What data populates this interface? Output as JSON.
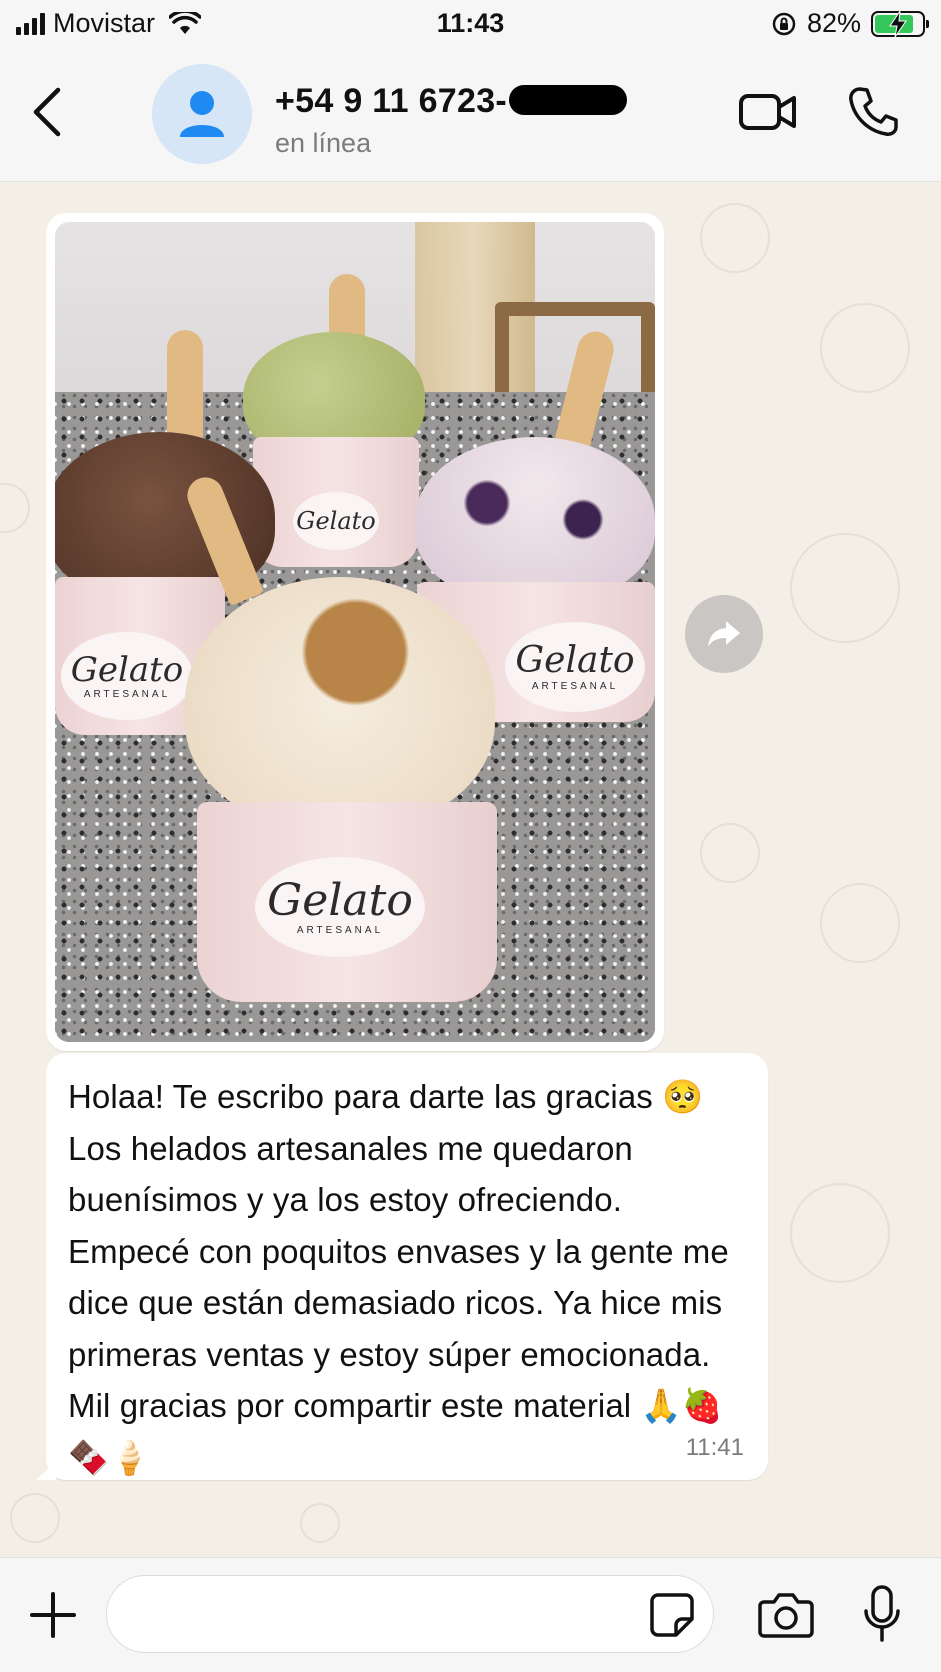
{
  "status_bar": {
    "carrier": "Movistar",
    "time": "11:43",
    "battery_percent": "82%",
    "battery_level": 0.82
  },
  "header": {
    "contact_name": "+54 9 11 6723-",
    "contact_status": "en línea"
  },
  "photo": {
    "cup_brand": "Gelato",
    "cup_subtitle": "ARTESANAL"
  },
  "message": {
    "text": "Holaa! Te escribo para darte las gracias 🥺 Los helados artesanales me quedaron buenísimos y ya los estoy ofreciendo. Empecé con poquitos envases y la gente me dice que están demasiado ricos. Ya hice mis primeras ventas y estoy súper emocionada. Mil gracias por compartir este material 🙏🍓🍫🍦",
    "time": "11:41"
  },
  "input": {
    "placeholder": ""
  },
  "icons": [
    "back-icon",
    "contact-avatar-icon",
    "video-call-icon",
    "phone-call-icon",
    "forward-icon",
    "plus-icon",
    "sticker-icon",
    "camera-icon",
    "microphone-icon"
  ],
  "colors": {
    "accent_blue": "#1f8bf2",
    "battery_green": "#34c759",
    "chat_background": "#f3eee6"
  }
}
